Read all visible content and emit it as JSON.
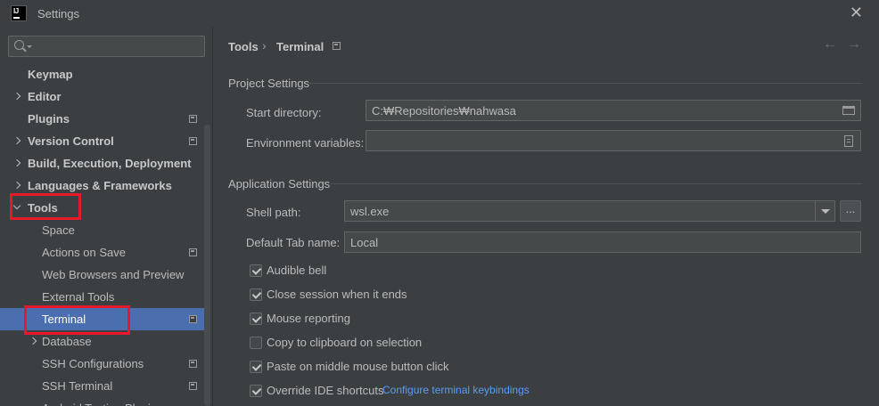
{
  "window": {
    "title": "Settings",
    "logo_text": "IJ",
    "close_glyph": "✕"
  },
  "sidebar": {
    "search": {
      "value": "",
      "placeholder": ""
    },
    "items": [
      {
        "label": "Keymap",
        "level": 1,
        "expand": "none",
        "project_icon": false
      },
      {
        "label": "Editor",
        "level": 1,
        "expand": "collapsed",
        "project_icon": false
      },
      {
        "label": "Plugins",
        "level": 1,
        "expand": "none",
        "project_icon": true
      },
      {
        "label": "Version Control",
        "level": 1,
        "expand": "collapsed",
        "project_icon": true
      },
      {
        "label": "Build, Execution, Deployment",
        "level": 1,
        "expand": "collapsed",
        "project_icon": false
      },
      {
        "label": "Languages & Frameworks",
        "level": 1,
        "expand": "collapsed",
        "project_icon": false
      },
      {
        "label": "Tools",
        "level": 1,
        "expand": "expanded",
        "project_icon": false
      },
      {
        "label": "Space",
        "level": 2,
        "expand": "none",
        "project_icon": false
      },
      {
        "label": "Actions on Save",
        "level": 2,
        "expand": "none",
        "project_icon": true
      },
      {
        "label": "Web Browsers and Preview",
        "level": 2,
        "expand": "none",
        "project_icon": false
      },
      {
        "label": "External Tools",
        "level": 2,
        "expand": "none",
        "project_icon": false
      },
      {
        "label": "Terminal",
        "level": 2,
        "expand": "none",
        "project_icon": true,
        "selected": true
      },
      {
        "label": "Database",
        "level": 2,
        "expand": "collapsed",
        "project_icon": false
      },
      {
        "label": "SSH Configurations",
        "level": 2,
        "expand": "none",
        "project_icon": true
      },
      {
        "label": "SSH Terminal",
        "level": 2,
        "expand": "none",
        "project_icon": true
      },
      {
        "label": "Android Testing Plugin",
        "level": 2,
        "expand": "none",
        "project_icon": false
      }
    ]
  },
  "main": {
    "breadcrumb": [
      "Tools",
      "Terminal"
    ],
    "breadcrumb_sep": "›",
    "back_glyph": "←",
    "forward_glyph": "→",
    "project_settings": {
      "title": "Project Settings",
      "start_directory_label": "Start directory:",
      "start_directory_value": "C:₩Repositories₩nahwasa",
      "env_vars_label": "Environment variables:",
      "env_vars_value": ""
    },
    "application_settings": {
      "title": "Application Settings",
      "shell_path_label": "Shell path:",
      "shell_path_value": "wsl.exe",
      "browse_label": "...",
      "default_tab_label": "Default Tab name:",
      "default_tab_value": "Local",
      "checkboxes": [
        {
          "label": "Audible bell",
          "checked": true
        },
        {
          "label": "Close session when it ends",
          "checked": true
        },
        {
          "label": "Mouse reporting",
          "checked": true
        },
        {
          "label": "Copy to clipboard on selection",
          "checked": false
        },
        {
          "label": "Paste on middle mouse button click",
          "checked": true
        },
        {
          "label": "Override IDE shortcuts",
          "checked": true
        }
      ],
      "keybindings_link": "Configure terminal keybindings"
    }
  },
  "colors": {
    "background": "#3c3f41",
    "selection": "#4b6eaf",
    "highlight_box": "#e8182a",
    "link": "#589df6"
  }
}
